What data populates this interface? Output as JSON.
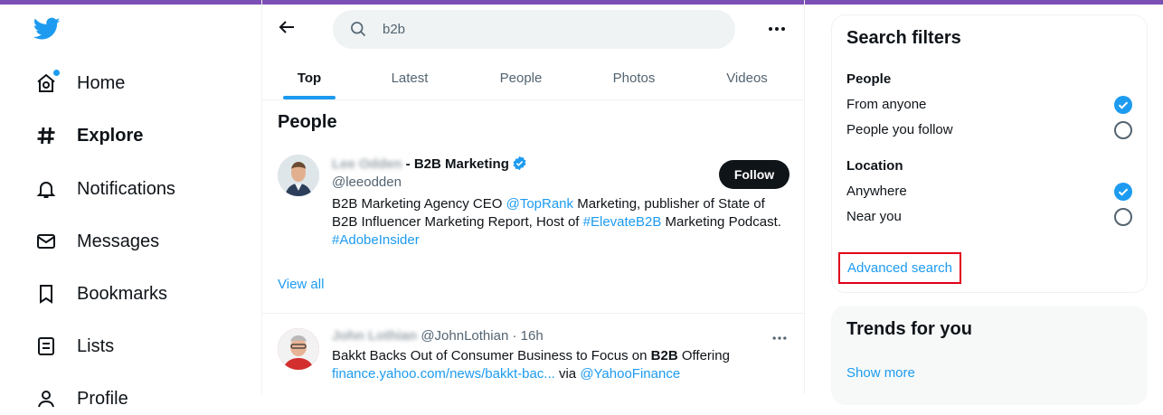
{
  "nav": {
    "items": [
      {
        "label": "Home",
        "icon": "home-icon"
      },
      {
        "label": "Explore",
        "icon": "hashtag-icon"
      },
      {
        "label": "Notifications",
        "icon": "bell-icon"
      },
      {
        "label": "Messages",
        "icon": "envelope-icon"
      },
      {
        "label": "Bookmarks",
        "icon": "bookmark-icon"
      },
      {
        "label": "Lists",
        "icon": "list-icon"
      },
      {
        "label": "Profile",
        "icon": "profile-icon"
      }
    ]
  },
  "search": {
    "value": "b2b"
  },
  "tabs": [
    {
      "label": "Top"
    },
    {
      "label": "Latest"
    },
    {
      "label": "People"
    },
    {
      "label": "Photos"
    },
    {
      "label": "Videos"
    }
  ],
  "people_section": {
    "title": "People",
    "user": {
      "name_blurred": "Lee Odden",
      "name_suffix": " - B2B Marketing",
      "handle": "@leeodden",
      "follow_label": "Follow",
      "bio_1": "B2B Marketing Agency CEO ",
      "bio_link_1": "@TopRank",
      "bio_2": " Marketing, publisher of State of B2B Influencer Marketing Report, Host of ",
      "bio_link_2": "#ElevateB2B",
      "bio_3": " Marketing Podcast. ",
      "bio_link_3": "#AdobeInsider"
    },
    "view_all": "View all"
  },
  "tweet": {
    "name_blurred": "John Lothian",
    "handle": "@JohnLothian",
    "sep": " · ",
    "time": "16h",
    "text_1": "Bakkt Backs Out of Consumer Business to Focus on ",
    "text_bold": "B2B",
    "text_2": " Offering",
    "link_1": "finance.yahoo.com/news/bakkt-bac...",
    "via": " via ",
    "link_2": "@YahooFinance"
  },
  "filters": {
    "title": "Search filters",
    "people_label": "People",
    "people_options": [
      "From anyone",
      "People you follow"
    ],
    "location_label": "Location",
    "location_options": [
      "Anywhere",
      "Near you"
    ],
    "advanced": "Advanced search"
  },
  "trends": {
    "title": "Trends for you",
    "show_more": "Show more"
  },
  "colors": {
    "accent": "#1d9bf0",
    "highlight_box": "#e0001a",
    "top_bar": "#7b4fb3"
  }
}
